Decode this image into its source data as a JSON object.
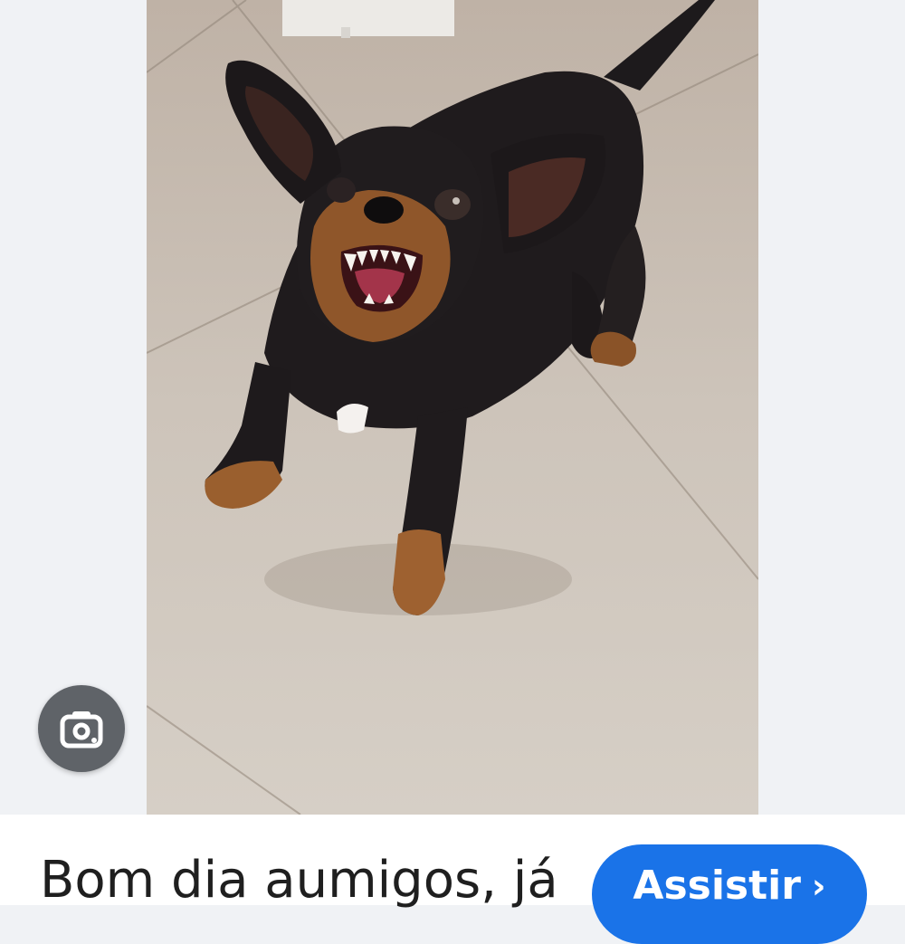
{
  "result_card": {
    "caption": "Bom dia aumigos, já",
    "watch_button_label": "Assistir",
    "watch_button_icon": "chevron-right-icon"
  },
  "lens_button": {
    "icon": "google-lens-icon"
  },
  "colors": {
    "accent": "#1a73e8",
    "lens_button_bg": "#5f6368",
    "page_background": "#f0f2f5"
  }
}
